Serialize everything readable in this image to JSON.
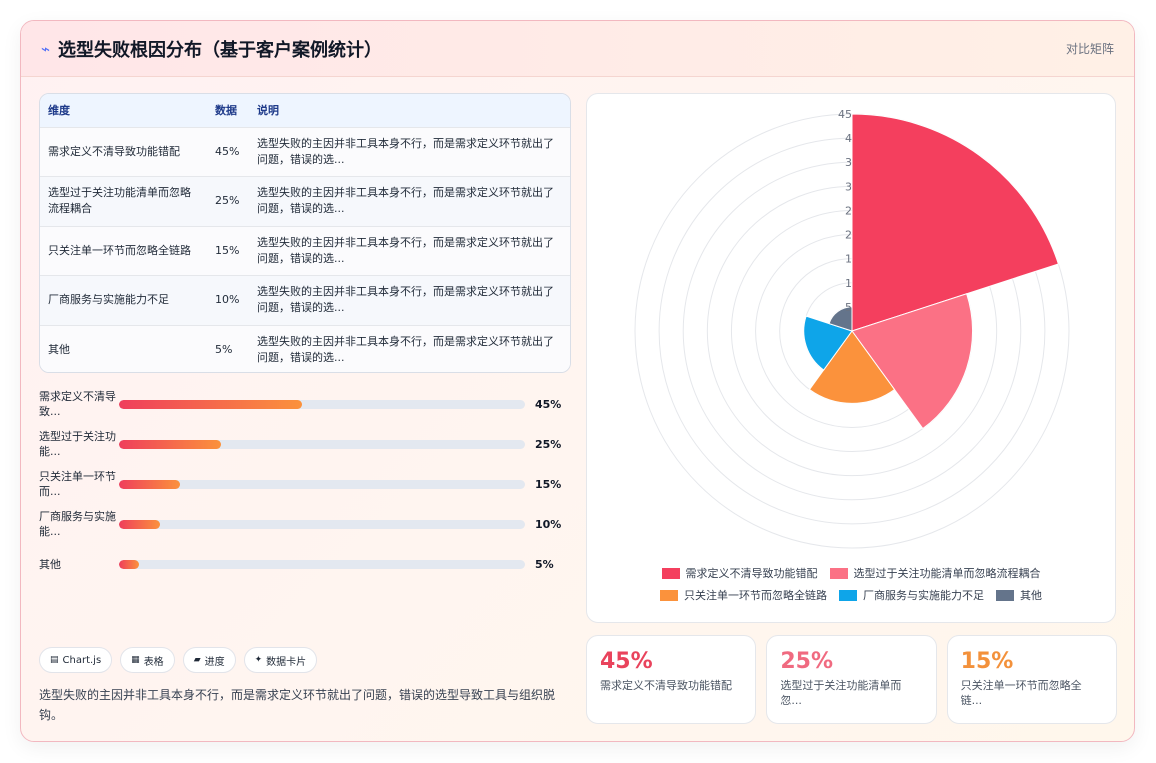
{
  "header": {
    "title": "选型失败根因分布（基于客户案例统计）",
    "right_label": "对比矩阵"
  },
  "table": {
    "columns": [
      "维度",
      "数据",
      "说明"
    ],
    "rows": [
      {
        "dim": "需求定义不清导致功能错配",
        "value": "45%",
        "note": "选型失败的主因并非工具本身不行，而是需求定义环节就出了问题，错误的选..."
      },
      {
        "dim": "选型过于关注功能清单而忽略流程耦合",
        "value": "25%",
        "note": "选型失败的主因并非工具本身不行，而是需求定义环节就出了问题，错误的选..."
      },
      {
        "dim": "只关注单一环节而忽略全链路",
        "value": "15%",
        "note": "选型失败的主因并非工具本身不行，而是需求定义环节就出了问题，错误的选..."
      },
      {
        "dim": "厂商服务与实施能力不足",
        "value": "10%",
        "note": "选型失败的主因并非工具本身不行，而是需求定义环节就出了问题，错误的选..."
      },
      {
        "dim": "其他",
        "value": "5%",
        "note": "选型失败的主因并非工具本身不行，而是需求定义环节就出了问题，错误的选..."
      }
    ]
  },
  "progress": [
    {
      "label": "需求定义不清导致...",
      "value": 45,
      "value_label": "45%"
    },
    {
      "label": "选型过于关注功能...",
      "value": 25,
      "value_label": "25%"
    },
    {
      "label": "只关注单一环节而...",
      "value": 15,
      "value_label": "15%"
    },
    {
      "label": "厂商服务与实施能...",
      "value": 10,
      "value_label": "10%"
    },
    {
      "label": "其他",
      "value": 5,
      "value_label": "5%"
    }
  ],
  "chips": [
    {
      "icon": "▤",
      "label": "Chart.js"
    },
    {
      "icon": "▦",
      "label": "表格"
    },
    {
      "icon": "▰",
      "label": "进度"
    },
    {
      "icon": "✦",
      "label": "数据卡片"
    }
  ],
  "description": "选型失败的主因并非工具本身不行，而是需求定义环节就出了问题，错误的选型导致工具与组织脱钩。",
  "chart_data": {
    "type": "polarArea",
    "categories": [
      "需求定义不清导致功能错配",
      "选型过于关注功能清单而忽略流程耦合",
      "只关注单一环节而忽略全链路",
      "厂商服务与实施能力不足",
      "其他"
    ],
    "values": [
      45,
      25,
      15,
      10,
      5
    ],
    "colors": [
      "#f43f5e",
      "#fb7185",
      "#fb923c",
      "#0ea5e9",
      "#64748b"
    ],
    "r_max": 45,
    "ticks": [
      5,
      10,
      15,
      20,
      25,
      30,
      35,
      40,
      45
    ],
    "tick_labels": [
      "5",
      "1",
      "1",
      "2",
      "2",
      "3",
      "3",
      "4",
      "45"
    ],
    "legend_position": "bottom",
    "grid": true
  },
  "stat_cards": [
    {
      "value": "45%",
      "label": "需求定义不清导致功能错配",
      "color": "#e9435c"
    },
    {
      "value": "25%",
      "label": "选型过于关注功能清单而忽...",
      "color": "#f06a80"
    },
    {
      "value": "15%",
      "label": "只关注单一环节而忽略全链...",
      "color": "#f3913b"
    }
  ]
}
